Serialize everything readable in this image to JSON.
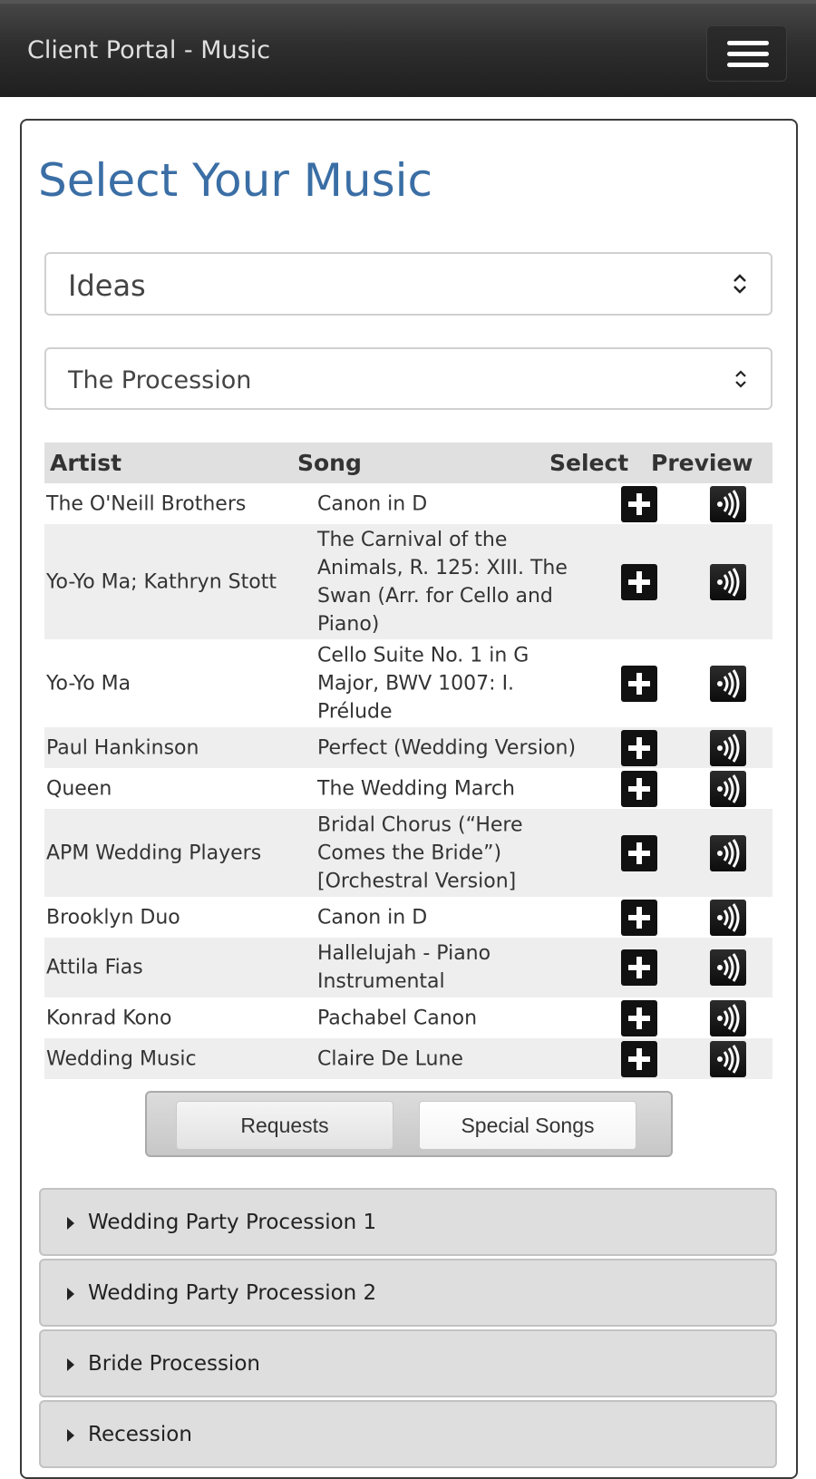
{
  "header": {
    "title": "Client Portal - Music",
    "menu_icon": "hamburger-icon"
  },
  "page_title": "Select Your Music",
  "selects": {
    "category": "Ideas",
    "moment": "The Procession"
  },
  "table": {
    "headers": {
      "artist": "Artist",
      "song": "Song",
      "select": "Select",
      "preview": "Preview"
    },
    "rows": [
      {
        "artist": "The O'Neill Brothers",
        "song": "Canon in D"
      },
      {
        "artist": "Yo-Yo Ma; Kathryn Stott",
        "song": "The Carnival of the Animals, R. 125: XIII. The Swan (Arr. for Cello and Piano)"
      },
      {
        "artist": "Yo-Yo Ma",
        "song": "Cello Suite No. 1 in G Major, BWV 1007: I. Prélude"
      },
      {
        "artist": "Paul Hankinson",
        "song": "Perfect (Wedding Version)"
      },
      {
        "artist": "Queen",
        "song": "The Wedding March"
      },
      {
        "artist": "APM Wedding Players",
        "song": "Bridal Chorus (“Here Comes the Bride”) [Orchestral Version]"
      },
      {
        "artist": "Brooklyn Duo",
        "song": "Canon in D"
      },
      {
        "artist": "Attila Fias",
        "song": "Hallelujah - Piano Instrumental"
      },
      {
        "artist": "Konrad Kono",
        "song": "Pachabel Canon"
      },
      {
        "artist": "Wedding Music",
        "song": "Claire De Lune"
      }
    ]
  },
  "tabs": {
    "requests": "Requests",
    "special_songs": "Special Songs"
  },
  "accordion": [
    {
      "label": "Wedding Party Procession 1"
    },
    {
      "label": "Wedding Party Procession 2"
    },
    {
      "label": "Bride Procession"
    },
    {
      "label": "Recession"
    }
  ]
}
